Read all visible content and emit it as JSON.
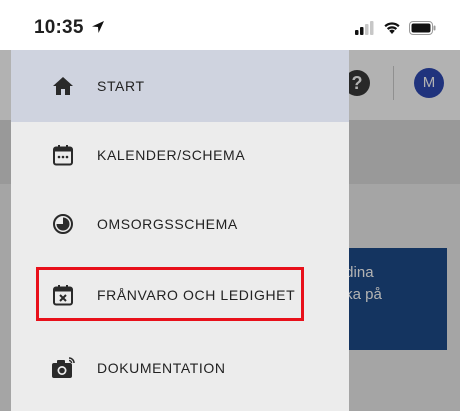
{
  "status_bar": {
    "time": "10:35"
  },
  "header": {
    "help_icon_glyph": "?",
    "avatar_initial": "M"
  },
  "background_card": {
    "line1": "lera dina",
    "line2": "i klicka på"
  },
  "drawer": {
    "items": [
      {
        "label": "START",
        "icon": "home-icon",
        "active": true
      },
      {
        "label": "KALENDER/SCHEMA",
        "icon": "calendar-icon",
        "active": false
      },
      {
        "label": "OMSORGSSCHEMA",
        "icon": "care-schedule-icon",
        "active": false
      },
      {
        "label": "FRÅNVARO OCH LEDIGHET",
        "icon": "absence-calendar-icon",
        "active": false,
        "highlighted": true
      },
      {
        "label": "DOKUMENTATION",
        "icon": "camera-icon",
        "active": false
      }
    ]
  },
  "colors": {
    "drawer_bg": "#ececec",
    "active_item_bg": "#cfd3df",
    "highlight_border": "#e8101a",
    "avatar_bg": "#2e49b4",
    "card_bg": "#1d4b8a"
  }
}
